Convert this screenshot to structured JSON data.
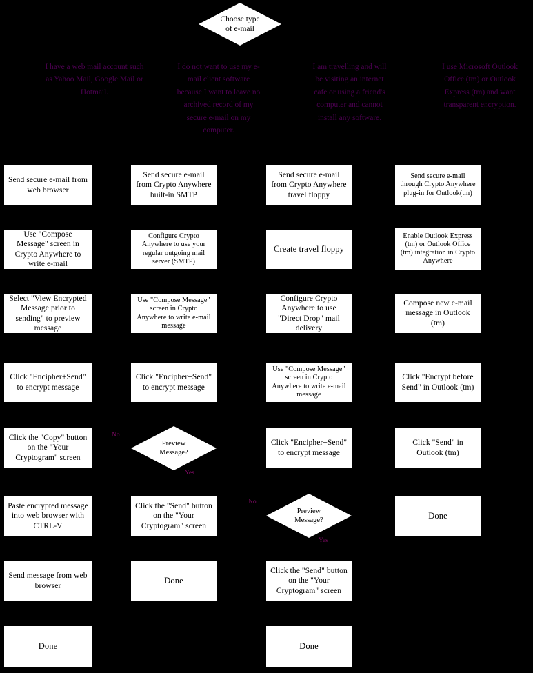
{
  "diagram": {
    "title": "Choose type of e-mail",
    "background_color": "#000000",
    "node_fill_color": "#ffffff",
    "node_text_color": "#000000",
    "rationale_text_color": "#4b0050",
    "edge_label_color": "#7d0a63"
  },
  "start": {
    "label": "Choose type\nof e-mail"
  },
  "rationales": [
    {
      "id": "rationale-web-mail",
      "text": "I have a web mail account such as Yahoo Mail, Google Mail or Hotmail."
    },
    {
      "id": "rationale-no-client",
      "text": "I do not want to use my e-mail client software because I want to leave no archived record of my secure e-mail on my computer."
    },
    {
      "id": "rationale-travelling",
      "text": "I am travelling and will be visiting an internet cafe or using a friend's computer and cannot install any software."
    },
    {
      "id": "rationale-outlook",
      "text": "I use Microsoft Outlook Office (tm) or Outlook Express (tm) and want transparent encryption."
    }
  ],
  "columns": [
    {
      "id": "column-web-browser",
      "steps": [
        "Send secure e-mail from web browser",
        "Use \"Compose Message\" screen in Crypto Anywhere to write e-mail",
        "Select \"View Encrypted Message prior to sending\" to preview message",
        "Click \"Encipher+Send\" to encrypt message",
        "Click the \"Copy\" button on the \"Your Cryptogram\" screen",
        "Paste encrypted message into web browser with CTRL-V",
        "Send message from web browser",
        "Done"
      ]
    },
    {
      "id": "column-builtin-smtp",
      "steps": [
        "Send secure e-mail from Crypto Anywhere built-in SMTP",
        "Configure Crypto Anywhere to use your regular outgoing mail server (SMTP)",
        "Use \"Compose Message\" screen in Crypto Anywhere to write e-mail message",
        "Click \"Encipher+Send\" to encrypt message",
        "Preview Message?",
        "Click the \"Send\" button on the \"Your Cryptogram\" screen",
        "Done"
      ]
    },
    {
      "id": "column-travel-floppy",
      "steps": [
        "Send secure e-mail from Crypto Anywhere travel floppy",
        "Create travel floppy",
        "Configure Crypto Anywhere to use \"Direct Drop\" mail delivery",
        "Use \"Compose Message\" screen in Crypto Anywhere to write e-mail message",
        "Click \"Encipher+Send\" to encrypt message",
        "Preview Message?",
        "Click the \"Send\" button on the \"Your Cryptogram\" screen",
        "Done"
      ]
    },
    {
      "id": "column-outlook-plugin",
      "steps": [
        "Send secure e-mail through Crypto Anywhere plug-in for Outlook(tm)",
        "Enable Outlook Express (tm) or Outlook Office (tm) integration in Crypto Anywhere",
        "Compose new e-mail message in Outlook (tm)",
        "Click \"Encrypt before Send\" in Outlook (tm)",
        "Click \"Send\" in Outlook (tm)",
        "Done"
      ]
    }
  ],
  "nodes": {
    "c1r1": "Send secure e-mail from web browser",
    "c1r2": "Use \"Compose Message\" screen in Crypto Anywhere to write e-mail",
    "c1r3": "Select \"View Encrypted Message prior to sending\" to preview message",
    "c1r4": "Click \"Encipher+Send\" to encrypt message",
    "c1r5": "Click the \"Copy\" button on the \"Your Cryptogram\" screen",
    "c1r6": "Paste encrypted message into web browser with CTRL-V",
    "c1r7": "Send message from web browser",
    "c1r8": "Done",
    "c2r1": "Send secure e-mail from Crypto Anywhere built-in SMTP",
    "c2r2": "Configure Crypto Anywhere to use your regular outgoing mail server (SMTP)",
    "c2r3": "Use \"Compose Message\" screen in Crypto Anywhere to write e-mail message",
    "c2r4": "Click \"Encipher+Send\" to encrypt message",
    "c2r5": "Preview Message?",
    "c2r6": "Click the \"Send\" button on the \"Your Cryptogram\" screen",
    "c2r7": "Done",
    "c3r1": "Send secure e-mail from Crypto Anywhere travel floppy",
    "c3r2": "Create travel floppy",
    "c3r3": "Configure Crypto Anywhere to use \"Direct Drop\" mail delivery",
    "c3r4": "Use \"Compose Message\" screen in Crypto Anywhere to write e-mail message",
    "c3r5": "Click \"Encipher+Send\" to encrypt message",
    "c3r6": "Preview Message?",
    "c3r7": "Click the \"Send\" button on the \"Your Cryptogram\" screen",
    "c3r8": "Done",
    "c4r1": "Send secure e-mail through Crypto Anywhere plug-in for Outlook(tm)",
    "c4r2": "Enable Outlook Express (tm) or Outlook Office (tm) integration in Crypto Anywhere",
    "c4r3": "Compose new e-mail message in Outlook (tm)",
    "c4r4": "Click \"Encrypt before Send\" in Outlook (tm)",
    "c4r5": "Click \"Send\" in Outlook (tm)",
    "c4r6": "Done"
  },
  "edge_labels": {
    "c2_no": "No",
    "c2_yes": "Yes",
    "c3_no": "No",
    "c3_yes": "Yes"
  }
}
